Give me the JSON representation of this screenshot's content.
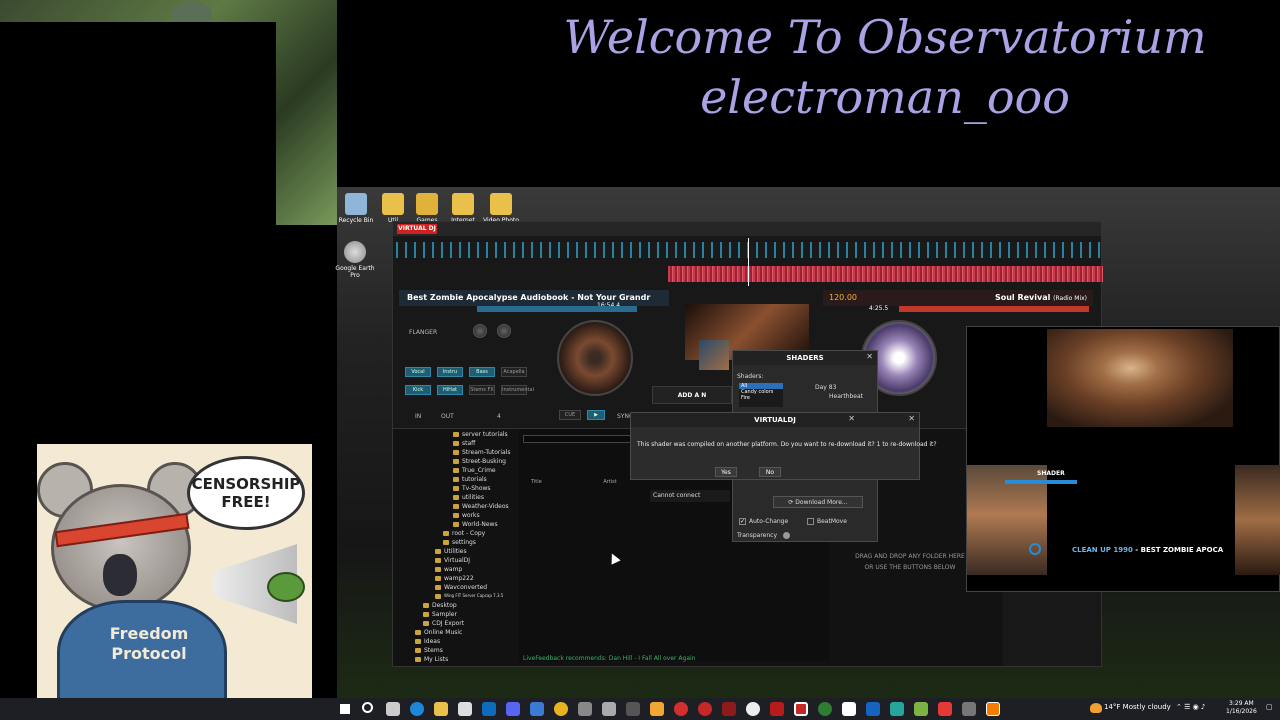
{
  "overlay": {
    "welcome": "Welcome To Observatorium",
    "username": "electroman_ooo"
  },
  "desktop_icons": [
    {
      "label": "Recycle Bin"
    },
    {
      "label": "Util"
    },
    {
      "label": "Games"
    },
    {
      "label": "Internet"
    },
    {
      "label": "Video Photo"
    },
    {
      "label": "Google Earth Pro"
    }
  ],
  "vdj": {
    "logo": "VIRTUAL DJ",
    "deck_left": {
      "title": "Best Zombie Apocalypse Audiobook - Not Your Grandr",
      "time": "16:54.4",
      "effect": "FLANGER",
      "pads": [
        "Vocal",
        "Instru",
        "Bass",
        "Acapella",
        "Kick",
        "HiHat",
        "Stems FX",
        "Instrumental"
      ],
      "loop_value": "4",
      "in_label": "IN",
      "out_label": "OUT",
      "cue_label": "CUE",
      "sync_label": "SYNC"
    },
    "deck_right": {
      "title": "Soul Revival",
      "subtitle": "(Radio Mix)",
      "bpm": "120.00",
      "time": "4:25.5"
    },
    "browser": {
      "tree": [
        "server tutorials",
        "staff",
        "Stream-Tutorials",
        "Street-Busking",
        "True_Crime",
        "tutorials",
        "Tv-Shows",
        "utilities",
        "Weather-Videos",
        "works",
        "World-News",
        "root - Copy",
        "settings",
        "Utilities",
        "VirtualDJ",
        "wamp",
        "wamp222",
        "Wavconverted",
        "Wing FIT Server Capcap 7.3.5",
        "Desktop",
        "Sampler",
        "CDJ Export",
        "Online Music",
        "Ideas",
        "Stems",
        "My Lists"
      ],
      "columns": {
        "title": "Title",
        "artist": "Artist"
      },
      "status": "LiveFeedback recommends: Dan Hill - I Fall All over Again",
      "drop_hint": "DRAG AND DROP ANY FOLDER HERE OR USE THE BUTTONS BELOW"
    }
  },
  "shaders_dialog": {
    "title": "SHADERS",
    "label": "Shaders:",
    "categories": [
      "All",
      "Candy colors",
      "Fire"
    ],
    "items": [
      "Day 83",
      "Hearthbeat"
    ],
    "download_label": "Download More...",
    "auto_change": "Auto-Change",
    "beat_move": "BeatMove",
    "transparency": "Transparency"
  },
  "confirm_dialog": {
    "title": "VIRTUALDJ",
    "message": "This shader was compiled on another platform. Do you want to re-download it?   1 to re-download it?",
    "yes": "Yes",
    "no": "No"
  },
  "add_box": "ADD A N",
  "cannot_connect": "Cannot connect",
  "video": {
    "shader_label": "SHADER",
    "now_playing_prefix": "CLEAN UP 1990",
    "now_playing_sep": " - ",
    "now_playing_title": "BEST ZOMBIE APOCA"
  },
  "meme": {
    "bubble": "CENSORSHIP FREE!",
    "hoodie": "Freedom Protocol"
  },
  "taskbar": {
    "weather": "14°F  Mostly cloudy",
    "time": "3:29 AM",
    "date": "1/16/2026"
  },
  "colors": {
    "welcome_text": "#a9a3e6",
    "accent_blue": "#2a8fb2",
    "accent_red": "#c73a4b"
  }
}
